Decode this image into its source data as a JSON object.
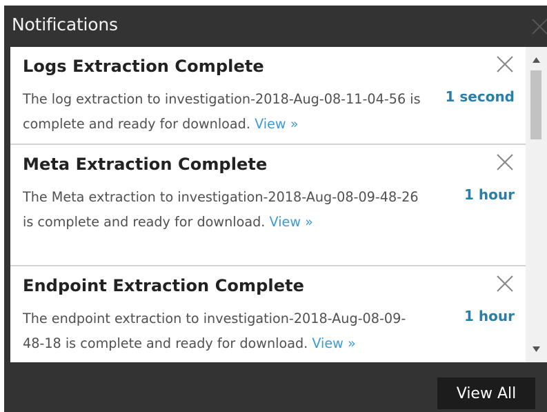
{
  "panel": {
    "title": "Notifications",
    "close_icon": "close-icon"
  },
  "notifications": [
    {
      "title": "Logs Extraction Complete",
      "message": "The log extraction to investigation-2018-Aug-08-11-04-56 is complete and ready for download.",
      "link": "View »",
      "time": "1 second",
      "close_icon": "close-icon"
    },
    {
      "title": "Meta Extraction Complete",
      "message": "The Meta extraction to investigation-2018-Aug-08-09-48-26 is complete and ready for download.",
      "link": "View »",
      "time": "1 hour",
      "close_icon": "close-icon"
    },
    {
      "title": "Endpoint Extraction Complete",
      "message": "The endpoint extraction to investigation-2018-Aug-08-09-48-18 is complete and ready for download.",
      "link": "View »",
      "time": "1 hour",
      "close_icon": "close-icon"
    }
  ],
  "scrollbar": {
    "up_icon": "arrow-up-icon",
    "down_icon": "arrow-down-icon"
  },
  "footer": {
    "view_all_label": "View All"
  },
  "colors": {
    "panel_bg": "#333333",
    "link": "#3a9ad9",
    "time": "#2a7fa8",
    "button_bg": "#1c1c1c"
  }
}
